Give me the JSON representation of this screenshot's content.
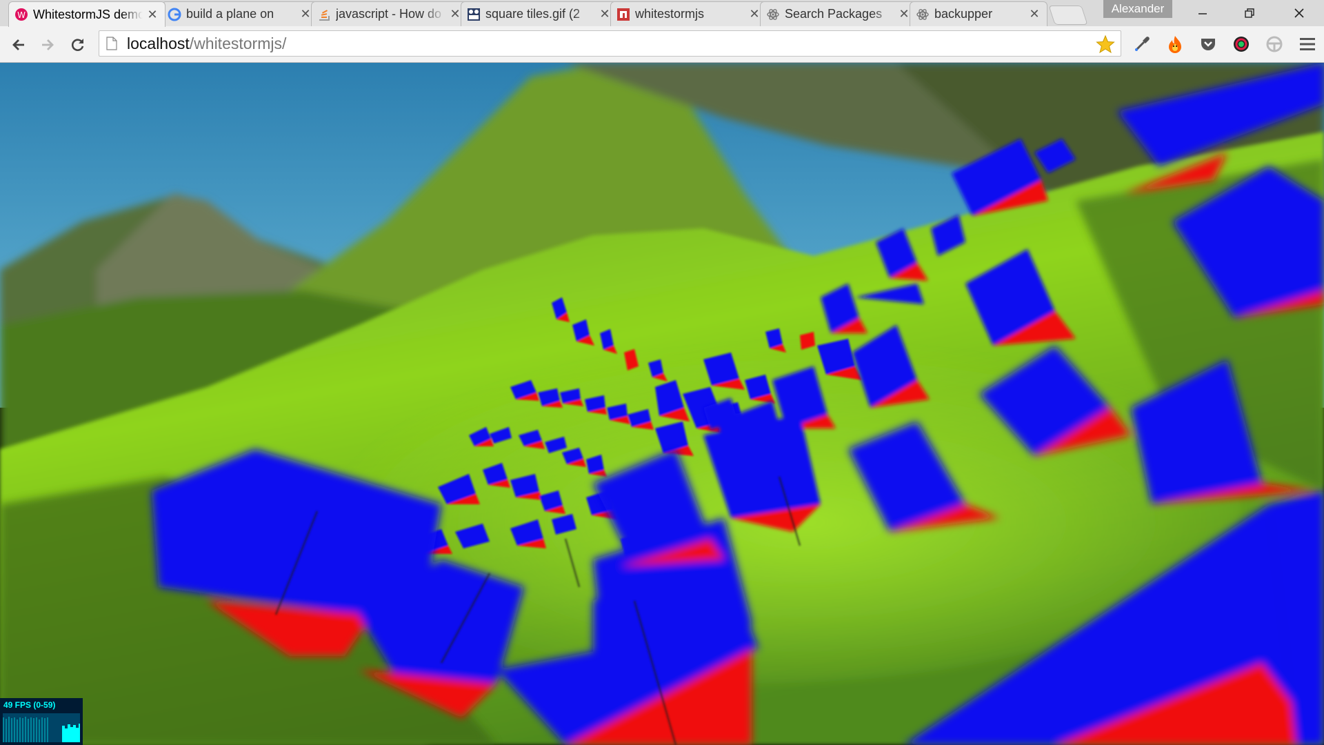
{
  "browser": {
    "tabs": [
      {
        "title": "WhitestormJS demo",
        "icon": "whitestorm-icon",
        "active": true
      },
      {
        "title": "build a plane on",
        "icon": "google-icon",
        "active": false
      },
      {
        "title": "javascript - How do",
        "icon": "stackoverflow-icon",
        "active": false
      },
      {
        "title": "square tiles.gif (2",
        "icon": "image-icon",
        "active": false
      },
      {
        "title": "whitestormjs",
        "icon": "npm-icon",
        "active": false
      },
      {
        "title": "Search Packages",
        "icon": "atom-icon",
        "active": false
      },
      {
        "title": "backupper",
        "icon": "atom-icon",
        "active": false
      }
    ],
    "profile_name": "Alexander",
    "url_host": "localhost",
    "url_path": "/whitestormjs/"
  },
  "stats": {
    "fps_text": "49 FPS (0-59)",
    "fps_current": 49,
    "fps_min": 0,
    "fps_max": 59
  },
  "colors": {
    "sky": "#4a9fc2",
    "terrain_light": "#8fd41e",
    "terrain_dark": "#3f6a12",
    "tile_top": "#0d10f0",
    "tile_side": "#f00d0d",
    "fps_text": "#00ffff"
  }
}
